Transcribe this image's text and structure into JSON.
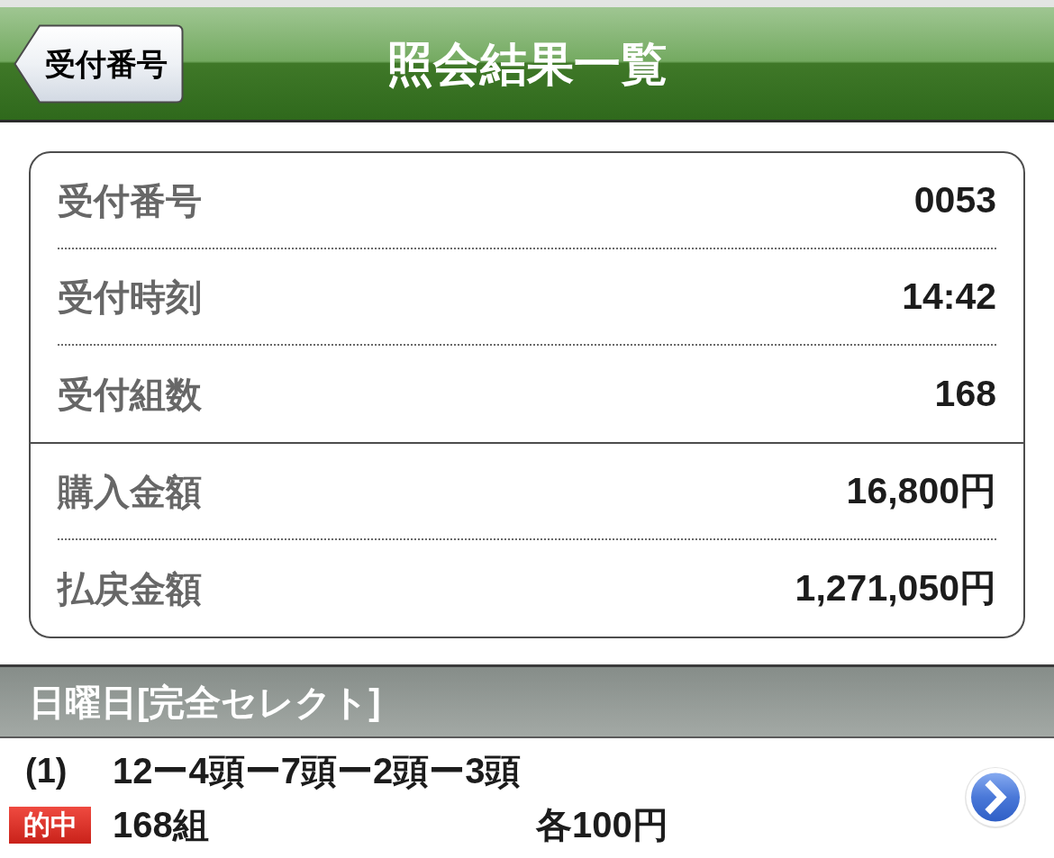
{
  "nav_bar": {
    "back_button": "受付番号",
    "title": "照会結果一覧"
  },
  "summary": {
    "groups": [
      {
        "rows": [
          {
            "label": "受付番号",
            "value": "0053"
          },
          {
            "label": "受付時刻",
            "value": "14:42"
          },
          {
            "label": "受付組数",
            "value": "168"
          }
        ]
      },
      {
        "rows": [
          {
            "label": "購入金額",
            "value": "16,800円"
          },
          {
            "label": "払戻金額",
            "value": "1,271,050円"
          }
        ]
      }
    ]
  },
  "section": {
    "title": "日曜日[完全セレクト]",
    "entries": [
      {
        "number": "(1)",
        "combination": "12ー4頭ー7頭ー2頭ー3頭",
        "badge": "的中",
        "count": "168組",
        "price": "各100円"
      }
    ]
  }
}
